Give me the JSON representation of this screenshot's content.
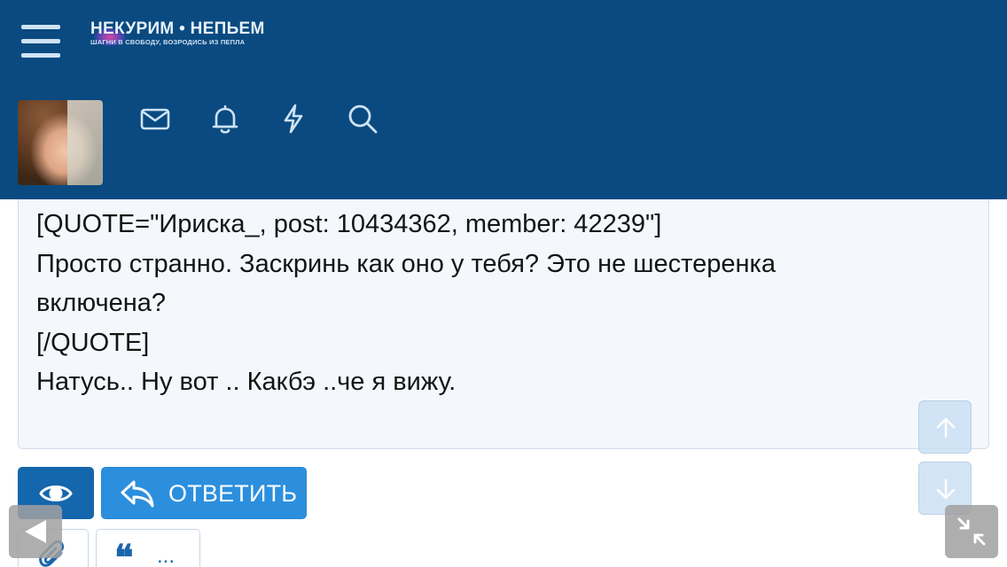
{
  "header": {
    "logo": {
      "title": "НЕКУРИМ • НЕПЬЕМ",
      "subtitle": "ШАГНИ В СВОБОДУ, ВОЗРОДИСЬ ИЗ ПЕПЛА"
    },
    "nav_icons": [
      "envelope-icon",
      "bell-icon",
      "lightning-icon",
      "search-icon"
    ]
  },
  "editor": {
    "lines": [
      "[QUOTE=\"Ириска_, post: 10434362, member: 42239\"]",
      "Просто странно. Заскринь как оно у тебя? Это не шестеренка",
      "включена?",
      "[/QUOTE]",
      "Натусь.. Ну вот ..  Какбэ ..че я вижу."
    ]
  },
  "actions": {
    "reply_label": "ОТВЕТИТЬ",
    "quote_label": "..."
  },
  "colors": {
    "header_bg": "#0a4a80",
    "primary_button": "#1466ad",
    "reply_button": "#2b8fde",
    "editor_bg": "#f4f8fc"
  }
}
